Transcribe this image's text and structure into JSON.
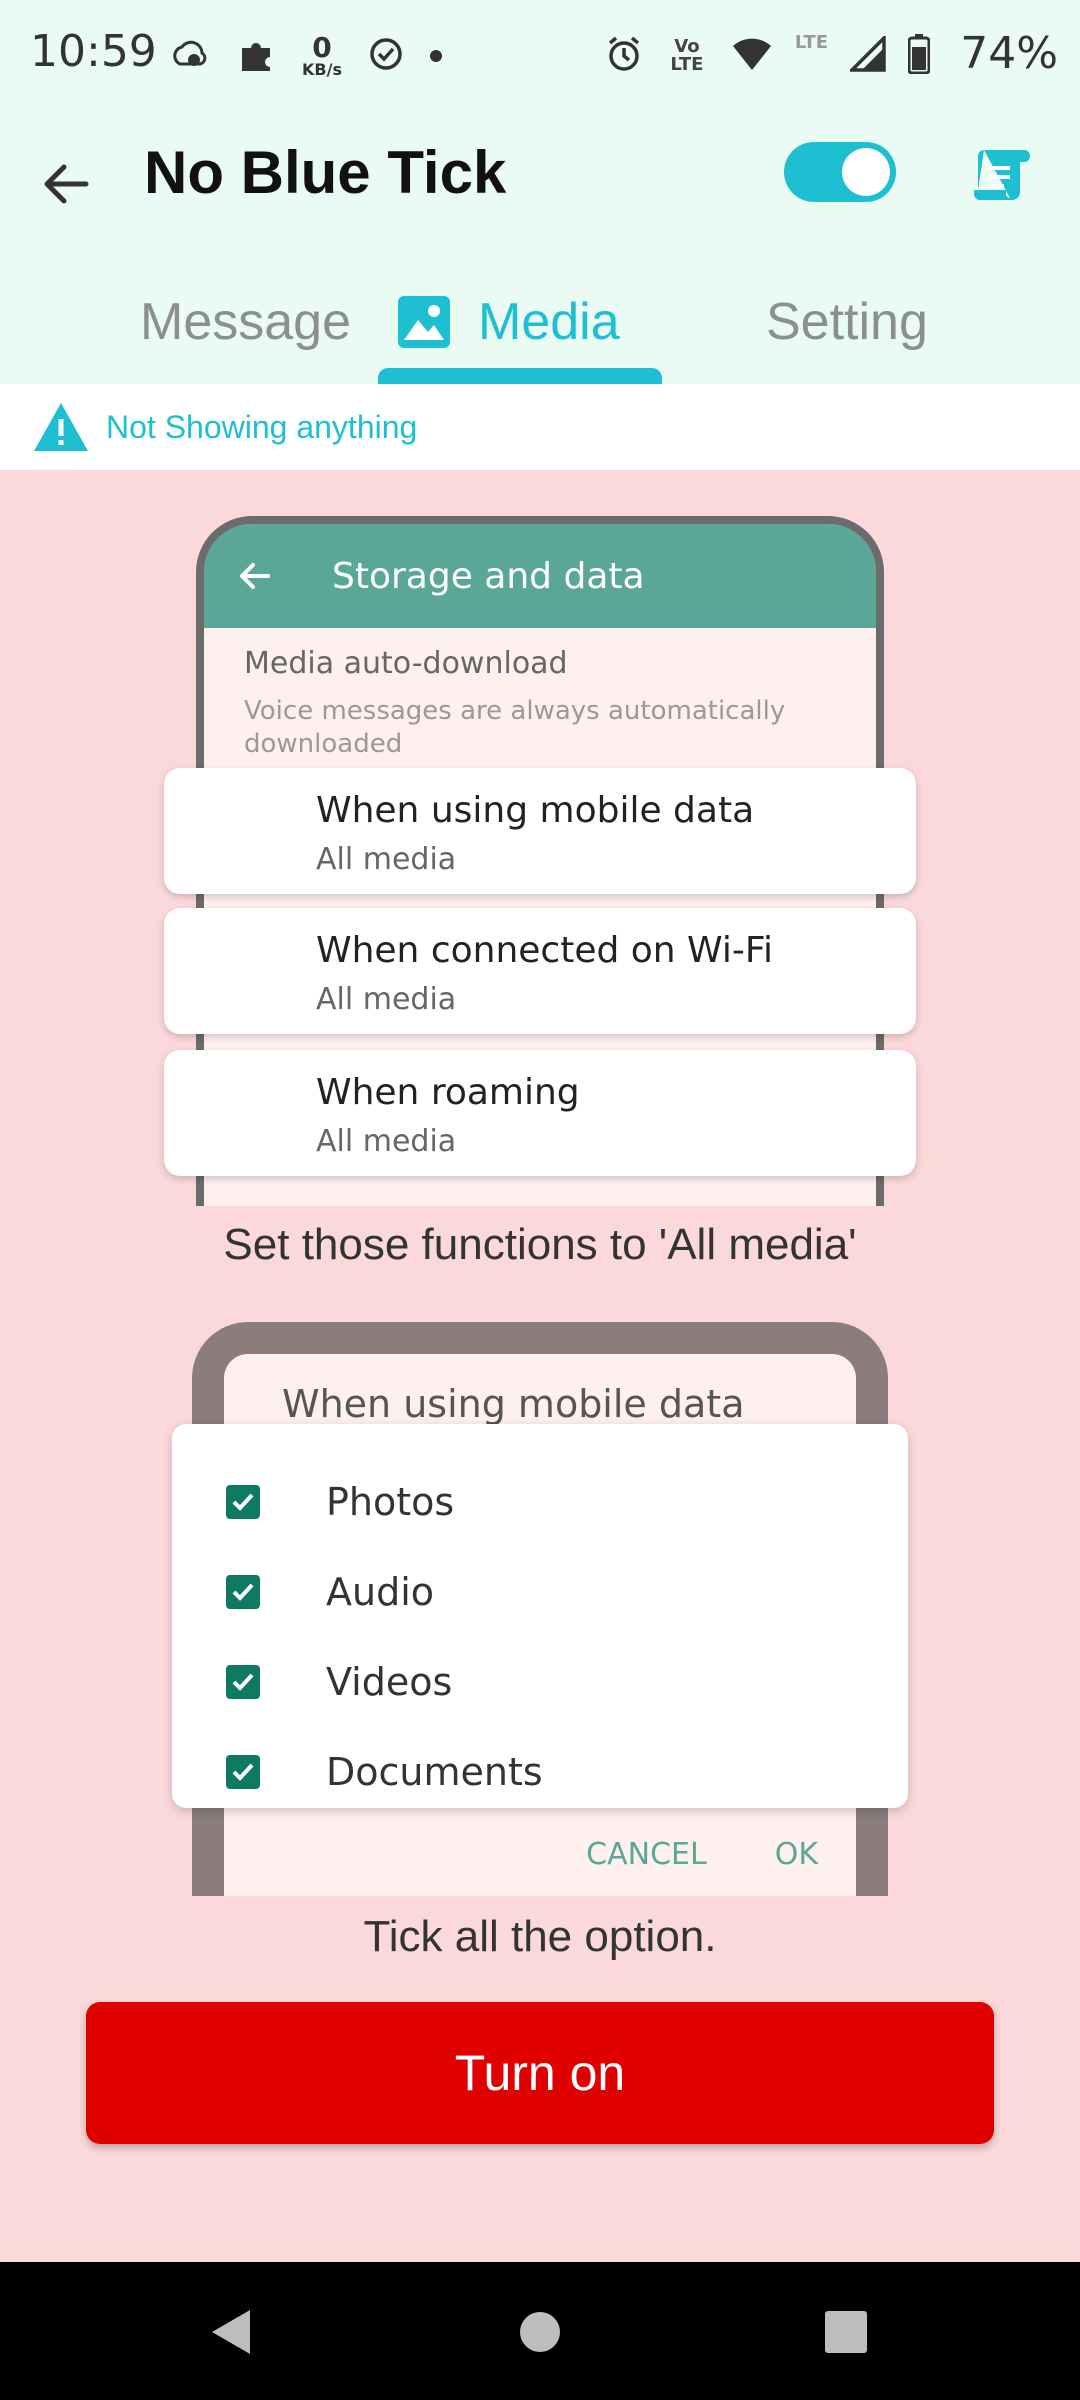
{
  "status_bar": {
    "time": "10:59",
    "speed_value": "0",
    "speed_unit": "KB/s",
    "volte": "Vo LTE",
    "lte": "LTE",
    "battery": "74%"
  },
  "app_bar": {
    "title": "No Blue Tick",
    "toggle_on": true
  },
  "tabs": [
    {
      "label": "Message",
      "active": false
    },
    {
      "label": "Media",
      "active": true
    },
    {
      "label": "Setting",
      "active": false
    }
  ],
  "warning": {
    "text": "Not Showing anything"
  },
  "illustration1": {
    "header_title": "Storage and data",
    "section": "Media auto-download",
    "description": "Voice messages are always automatically downloaded",
    "cards": [
      {
        "title": "When using mobile data",
        "subtitle": "All media"
      },
      {
        "title": "When connected on Wi-Fi",
        "subtitle": "All media"
      },
      {
        "title": "When roaming",
        "subtitle": "All media"
      }
    ],
    "caption": "Set those functions to 'All media'"
  },
  "illustration2": {
    "title": "When using mobile data",
    "options": [
      "Photos",
      "Audio",
      "Videos",
      "Documents"
    ],
    "cancel": "CANCEL",
    "ok": "OK",
    "caption": "Tick all the option."
  },
  "button": {
    "label": "Turn on"
  },
  "colors": {
    "accent": "#1dbfd1",
    "danger": "#e00000",
    "background": "#fbd9da",
    "header_bg": "#e9fbf3"
  }
}
